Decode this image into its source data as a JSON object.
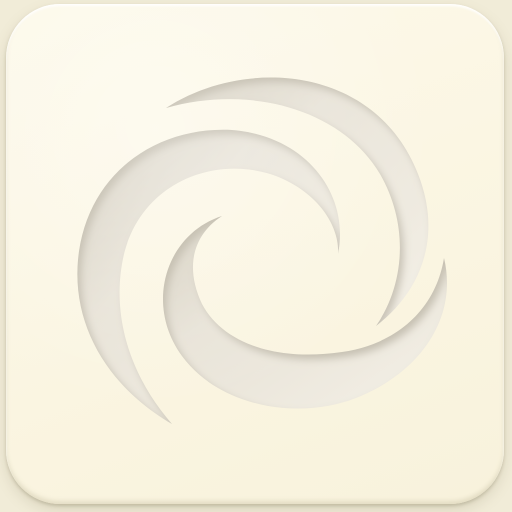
{
  "icon": {
    "name": "swirl-app-icon",
    "shape": "rounded-square",
    "glyph": "spiral-swirl",
    "colors": {
      "background": "#f1ecd8",
      "tile": "#fbf6e3",
      "engrave_light": "#f3efe6",
      "engrave_shade": "#d8d2c2",
      "engrave_deep": "#c9c2b0"
    }
  }
}
